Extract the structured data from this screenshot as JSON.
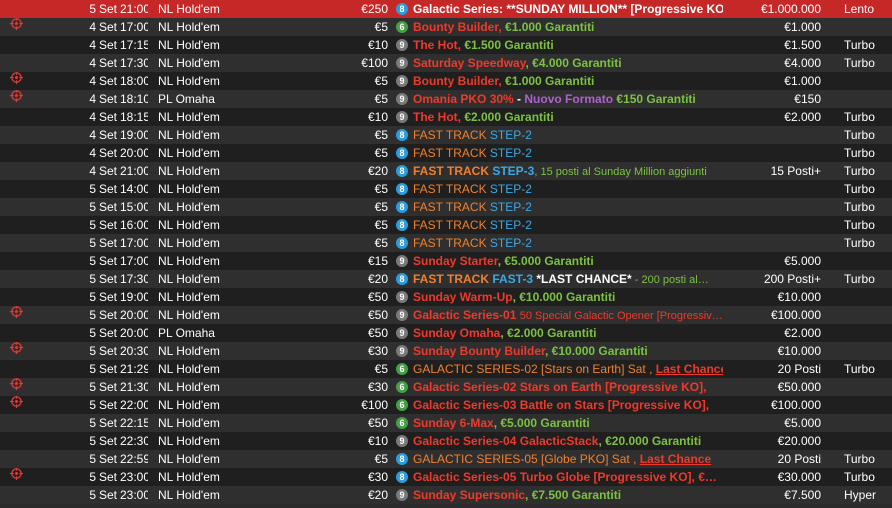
{
  "colors": {
    "highlight_row": "#c62828",
    "row_dark": "#1f1f1f",
    "row_light": "#2f2f2f",
    "text_red": "#ee3a2c",
    "text_green": "#7cc242",
    "text_orange": "#f08030",
    "text_blue": "#3aa9e6",
    "badge_8": "#2d9cdb",
    "badge_6": "#43a047",
    "badge_9": "#7a7a7a"
  },
  "tournaments": [
    {
      "icon": "",
      "day": "5",
      "month": "Set",
      "time": "21:00",
      "game": "NL Hold'em",
      "buyin": "€250",
      "badge": "8",
      "title": [
        {
          "t": "Galactic Series: **SUNDAY MILLION** [Progressive KO],",
          "c": "white",
          "b": true
        }
      ],
      "prize": "€1.000.000",
      "speed": "Lento",
      "highlight": true
    },
    {
      "icon": "target-icon",
      "day": "4",
      "month": "Set",
      "time": "17:00",
      "game": "NL Hold'em",
      "buyin": "€5",
      "badge": "6",
      "title": [
        {
          "t": "Bounty Builder, ",
          "c": "red",
          "b": true
        },
        {
          "t": "€1.000 Garantiti",
          "c": "green",
          "b": true
        }
      ],
      "prize": "€1.000",
      "speed": ""
    },
    {
      "icon": "",
      "day": "4",
      "month": "Set",
      "time": "17:15",
      "game": "NL Hold'em",
      "buyin": "€10",
      "badge": "9",
      "title": [
        {
          "t": "The Hot, ",
          "c": "red",
          "b": true
        },
        {
          "t": "€1.500 Garantiti",
          "c": "green",
          "b": true
        }
      ],
      "prize": "€1.500",
      "speed": "Turbo"
    },
    {
      "icon": "",
      "day": "4",
      "month": "Set",
      "time": "17:30",
      "game": "NL Hold'em",
      "buyin": "€100",
      "badge": "9",
      "title": [
        {
          "t": "Saturday Speedway",
          "c": "red",
          "b": true
        },
        {
          "t": ", €4.000 Garantiti",
          "c": "green",
          "b": true
        }
      ],
      "prize": "€4.000",
      "speed": "Turbo"
    },
    {
      "icon": "target-icon",
      "day": "4",
      "month": "Set",
      "time": "18:00",
      "game": "NL Hold'em",
      "buyin": "€5",
      "badge": "9",
      "title": [
        {
          "t": "Bounty Builder, ",
          "c": "red",
          "b": true
        },
        {
          "t": "€1.000 Garantiti",
          "c": "green",
          "b": true
        }
      ],
      "prize": "€1.000",
      "speed": ""
    },
    {
      "icon": "target-icon",
      "day": "4",
      "month": "Set",
      "time": "18:10",
      "game": "PL Omaha",
      "buyin": "€5",
      "badge": "9",
      "title": [
        {
          "t": "Omania PKO 30%",
          "c": "red",
          "b": true
        },
        {
          "t": " - ",
          "c": "white",
          "b": true
        },
        {
          "t": "Nuovo Formato ",
          "c": "purple",
          "b": true
        },
        {
          "t": "€150 Garantiti",
          "c": "green",
          "b": true
        }
      ],
      "prize": "€150",
      "speed": ""
    },
    {
      "icon": "",
      "day": "4",
      "month": "Set",
      "time": "18:15",
      "game": "NL Hold'em",
      "buyin": "€10",
      "badge": "9",
      "title": [
        {
          "t": "The Hot, ",
          "c": "red",
          "b": true
        },
        {
          "t": "€2.000 Garantiti",
          "c": "green",
          "b": true
        }
      ],
      "prize": "€2.000",
      "speed": "Turbo"
    },
    {
      "icon": "",
      "day": "4",
      "month": "Set",
      "time": "19:00",
      "game": "NL Hold'em",
      "buyin": "€5",
      "badge": "8",
      "title": [
        {
          "t": "FAST TRACK ",
          "c": "orange",
          "b": false
        },
        {
          "t": "STEP-2",
          "c": "blue",
          "b": false
        }
      ],
      "prize": "",
      "speed": "Turbo"
    },
    {
      "icon": "",
      "day": "4",
      "month": "Set",
      "time": "20:00",
      "game": "NL Hold'em",
      "buyin": "€5",
      "badge": "8",
      "title": [
        {
          "t": "FAST TRACK ",
          "c": "orange",
          "b": false
        },
        {
          "t": "STEP-2",
          "c": "blue",
          "b": false
        }
      ],
      "prize": "",
      "speed": "Turbo"
    },
    {
      "icon": "",
      "day": "4",
      "month": "Set",
      "time": "21:00",
      "game": "NL Hold'em",
      "buyin": "€20",
      "badge": "8",
      "title": [
        {
          "t": "FAST TRACK ",
          "c": "orange",
          "b": true
        },
        {
          "t": "STEP-3",
          "c": "blue",
          "b": true
        },
        {
          "t": ", 15 posti al Sunday Million aggiunti",
          "c": "green",
          "b": false,
          "small": true
        }
      ],
      "prize": "15 Posti+",
      "speed": "Turbo"
    },
    {
      "icon": "",
      "day": "5",
      "month": "Set",
      "time": "14:00",
      "game": "NL Hold'em",
      "buyin": "€5",
      "badge": "8",
      "title": [
        {
          "t": "FAST TRACK ",
          "c": "orange",
          "b": false
        },
        {
          "t": "STEP-2",
          "c": "blue",
          "b": false
        }
      ],
      "prize": "",
      "speed": "Turbo"
    },
    {
      "icon": "",
      "day": "5",
      "month": "Set",
      "time": "15:00",
      "game": "NL Hold'em",
      "buyin": "€5",
      "badge": "8",
      "title": [
        {
          "t": "FAST TRACK ",
          "c": "orange",
          "b": false
        },
        {
          "t": "STEP-2",
          "c": "blue",
          "b": false
        }
      ],
      "prize": "",
      "speed": "Turbo"
    },
    {
      "icon": "",
      "day": "5",
      "month": "Set",
      "time": "16:00",
      "game": "NL Hold'em",
      "buyin": "€5",
      "badge": "8",
      "title": [
        {
          "t": "FAST TRACK ",
          "c": "orange",
          "b": false
        },
        {
          "t": "STEP-2",
          "c": "blue",
          "b": false
        }
      ],
      "prize": "",
      "speed": "Turbo"
    },
    {
      "icon": "",
      "day": "5",
      "month": "Set",
      "time": "17:00",
      "game": "NL Hold'em",
      "buyin": "€5",
      "badge": "8",
      "title": [
        {
          "t": "FAST TRACK ",
          "c": "orange",
          "b": false
        },
        {
          "t": "STEP-2",
          "c": "blue",
          "b": false
        }
      ],
      "prize": "",
      "speed": "Turbo"
    },
    {
      "icon": "",
      "day": "5",
      "month": "Set",
      "time": "17:00",
      "game": "NL Hold'em",
      "buyin": "€15",
      "badge": "9",
      "title": [
        {
          "t": "Sunday Starter",
          "c": "red",
          "b": true
        },
        {
          "t": ", €5.000 Garantiti",
          "c": "green",
          "b": true
        }
      ],
      "prize": "€5.000",
      "speed": ""
    },
    {
      "icon": "",
      "day": "5",
      "month": "Set",
      "time": "17:30",
      "game": "NL Hold'em",
      "buyin": "€20",
      "badge": "8",
      "title": [
        {
          "t": "FAST TRACK ",
          "c": "orange",
          "b": true
        },
        {
          "t": "FAST-3",
          "c": "blue",
          "b": true
        },
        {
          "t": " *LAST CHANCE*",
          "c": "white",
          "b": true
        },
        {
          "t": " - 200 posti al…",
          "c": "green",
          "b": false,
          "small": true
        }
      ],
      "prize": "200 Posti+",
      "speed": "Turbo"
    },
    {
      "icon": "",
      "day": "5",
      "month": "Set",
      "time": "19:00",
      "game": "NL Hold'em",
      "buyin": "€50",
      "badge": "9",
      "title": [
        {
          "t": "Sunday Warm-Up",
          "c": "red",
          "b": true
        },
        {
          "t": ", €10.000 Garantiti",
          "c": "green",
          "b": true
        }
      ],
      "prize": "€10.000",
      "speed": ""
    },
    {
      "icon": "target-icon",
      "day": "5",
      "month": "Set",
      "time": "20:00",
      "game": "NL Hold'em",
      "buyin": "€50",
      "badge": "9",
      "title": [
        {
          "t": "Galactic Series-01 ",
          "c": "red",
          "b": true
        },
        {
          "t": "50 Special Galactic Opener [Progressiv…",
          "c": "red",
          "b": false,
          "small": true
        }
      ],
      "prize": "€100.000",
      "speed": ""
    },
    {
      "icon": "",
      "day": "5",
      "month": "Set",
      "time": "20:00",
      "game": "PL Omaha",
      "buyin": "€50",
      "badge": "9",
      "title": [
        {
          "t": "Sunday Omaha",
          "c": "red",
          "b": true
        },
        {
          "t": ", €2.000 Garantiti",
          "c": "green",
          "b": true
        }
      ],
      "prize": "€2.000",
      "speed": ""
    },
    {
      "icon": "target-icon",
      "day": "5",
      "month": "Set",
      "time": "20:30",
      "game": "NL Hold'em",
      "buyin": "€30",
      "badge": "9",
      "title": [
        {
          "t": "Sunday Bounty Builder",
          "c": "red",
          "b": true
        },
        {
          "t": ", €10.000 Garantiti",
          "c": "green",
          "b": true
        }
      ],
      "prize": "€10.000",
      "speed": ""
    },
    {
      "icon": "",
      "day": "5",
      "month": "Set",
      "time": "21:29",
      "game": "NL Hold'em",
      "buyin": "€5",
      "badge": "6",
      "title": [
        {
          "t": "GALACTIC SERIES-02 [Stars on Earth] Sat , ",
          "c": "orange",
          "b": false
        },
        {
          "t": "Last Chance",
          "c": "red",
          "b": true,
          "u": true
        }
      ],
      "prize": "20 Posti",
      "speed": "Turbo"
    },
    {
      "icon": "target-icon",
      "day": "5",
      "month": "Set",
      "time": "21:30",
      "game": "NL Hold'em",
      "buyin": "€30",
      "badge": "6",
      "title": [
        {
          "t": "Galactic Series-02 Stars on Earth [Progressive KO],",
          "c": "red",
          "b": true
        }
      ],
      "prize": "€50.000",
      "speed": ""
    },
    {
      "icon": "target-icon",
      "day": "5",
      "month": "Set",
      "time": "22:00",
      "game": "NL Hold'em",
      "buyin": "€100",
      "badge": "6",
      "title": [
        {
          "t": "Galactic Series-03 Battle on Stars [Progressive KO],",
          "c": "red",
          "b": true
        }
      ],
      "prize": "€100.000",
      "speed": ""
    },
    {
      "icon": "",
      "day": "5",
      "month": "Set",
      "time": "22:15",
      "game": "NL Hold'em",
      "buyin": "€50",
      "badge": "6",
      "title": [
        {
          "t": "Sunday 6-Max",
          "c": "red",
          "b": true
        },
        {
          "t": ", €5.000 Garantiti",
          "c": "green",
          "b": true
        }
      ],
      "prize": "€5.000",
      "speed": ""
    },
    {
      "icon": "",
      "day": "5",
      "month": "Set",
      "time": "22:30",
      "game": "NL Hold'em",
      "buyin": "€10",
      "badge": "9",
      "title": [
        {
          "t": "Galactic Series-04 GalacticStack",
          "c": "red",
          "b": true
        },
        {
          "t": ", €20.000 Garantiti",
          "c": "green",
          "b": true
        }
      ],
      "prize": "€20.000",
      "speed": ""
    },
    {
      "icon": "",
      "day": "5",
      "month": "Set",
      "time": "22:59",
      "game": "NL Hold'em",
      "buyin": "€5",
      "badge": "8",
      "title": [
        {
          "t": "GALACTIC SERIES-05 [Globe PKO] Sat , ",
          "c": "orange",
          "b": false
        },
        {
          "t": "Last Chance",
          "c": "red",
          "b": true,
          "u": true
        }
      ],
      "prize": "20 Posti",
      "speed": "Turbo"
    },
    {
      "icon": "target-icon",
      "day": "5",
      "month": "Set",
      "time": "23:00",
      "game": "NL Hold'em",
      "buyin": "€30",
      "badge": "8",
      "title": [
        {
          "t": "Galactic Series-05 Turbo Globe [Progressive KO], €…",
          "c": "red",
          "b": true
        }
      ],
      "prize": "€30.000",
      "speed": "Turbo"
    },
    {
      "icon": "",
      "day": "5",
      "month": "Set",
      "time": "23:00",
      "game": "NL Hold'em",
      "buyin": "€20",
      "badge": "9",
      "title": [
        {
          "t": "Sunday Supersonic",
          "c": "red",
          "b": true
        },
        {
          "t": ", €7.500 Garantiti",
          "c": "green",
          "b": true
        }
      ],
      "prize": "€7.500",
      "speed": "Hyper"
    }
  ]
}
